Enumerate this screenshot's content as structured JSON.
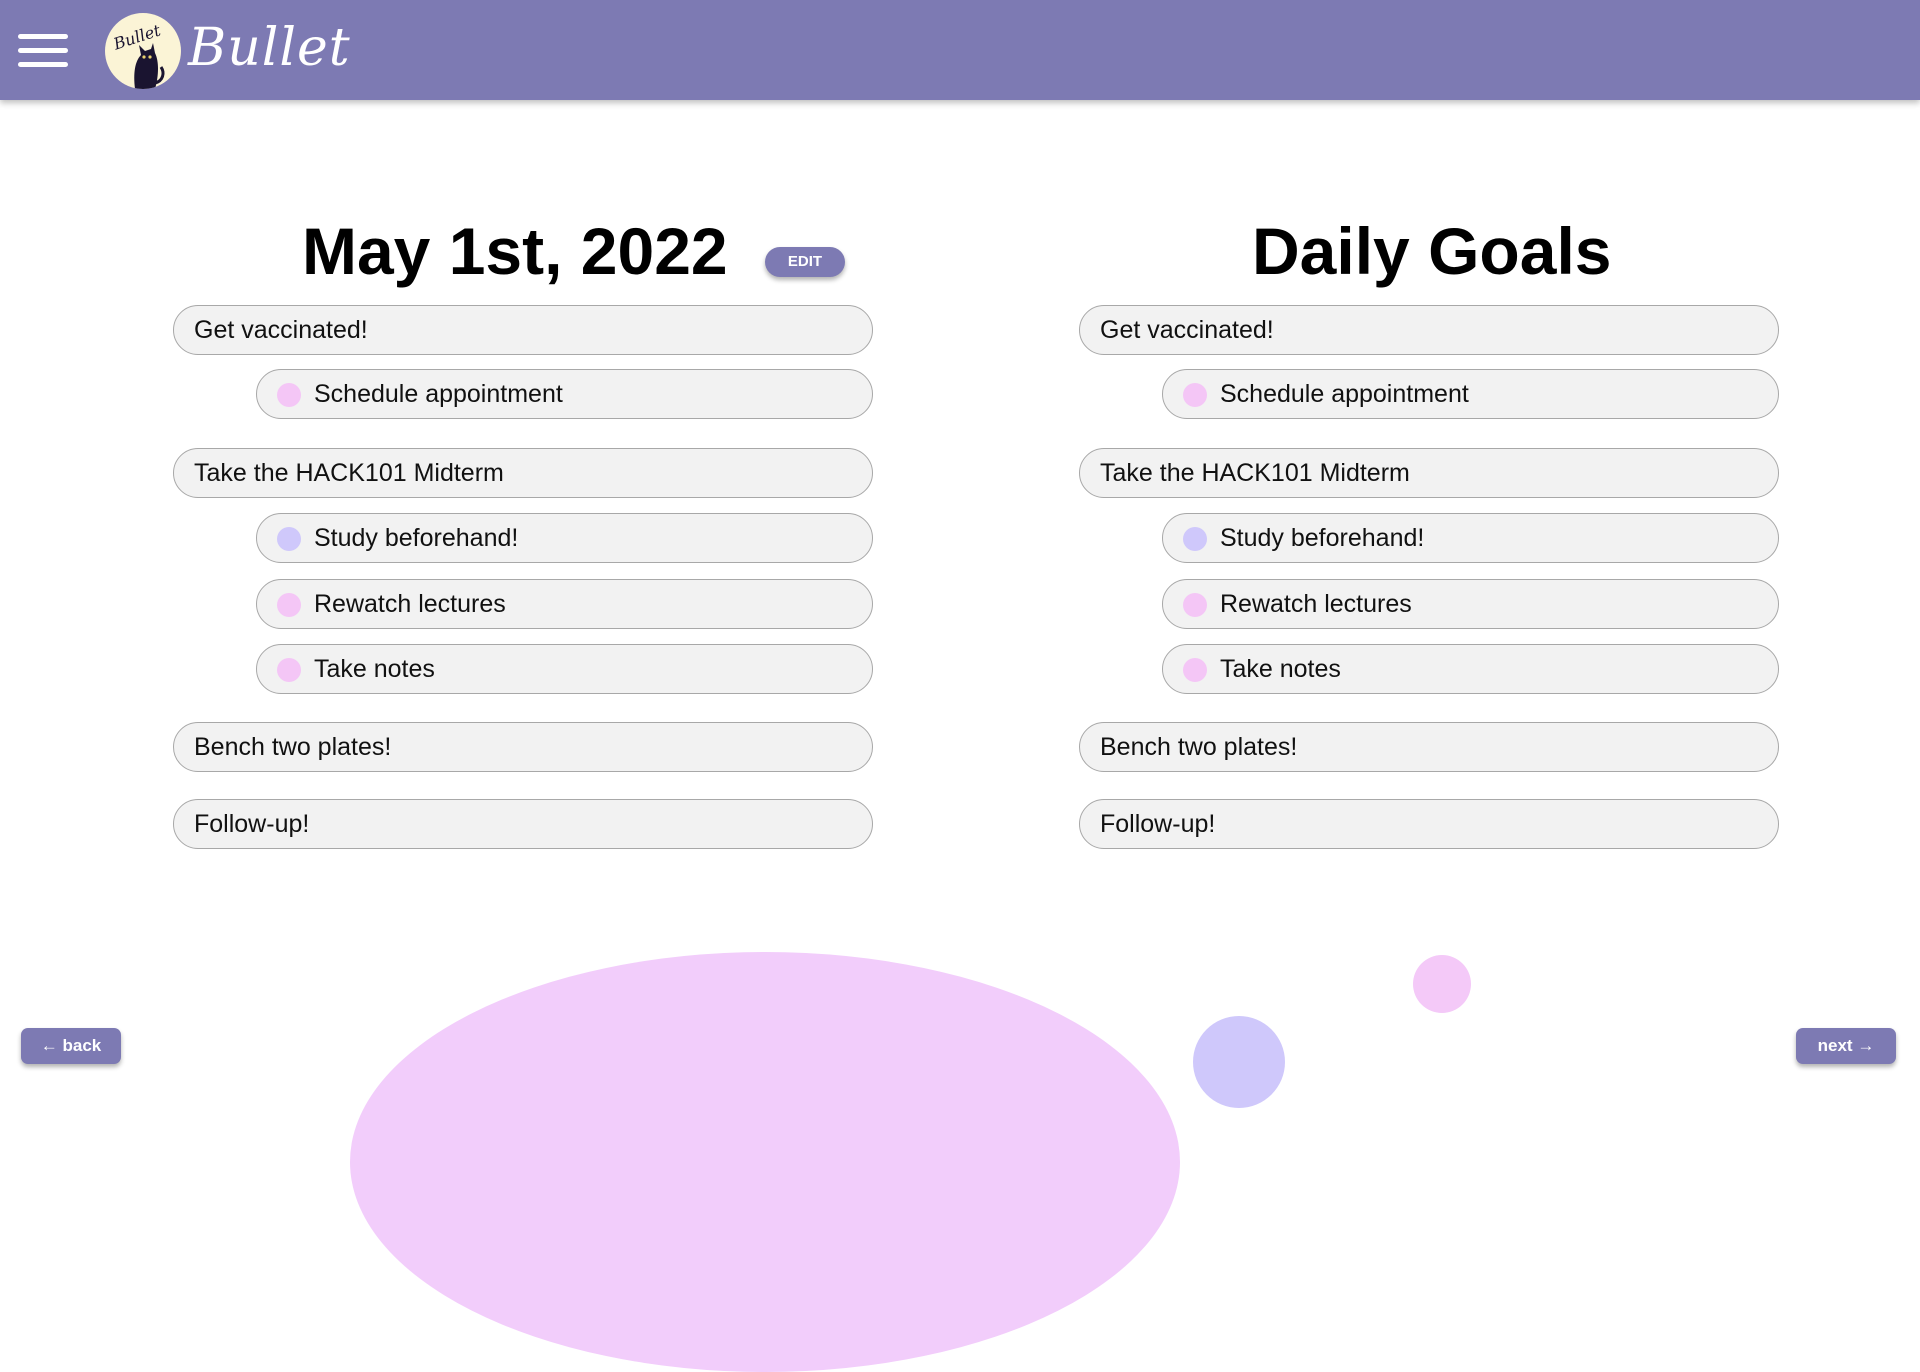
{
  "app": {
    "brand": "Bullet"
  },
  "journal": {
    "title": "May 1st, 2022",
    "edit_label": "EDIT",
    "items": [
      {
        "label": "Get vaccinated!"
      },
      {
        "label": "Schedule appointment",
        "dot_color": "#f4c6f6"
      },
      {
        "label": "Take the HACK101 Midterm"
      },
      {
        "label": "Study beforehand!",
        "dot_color": "#cfc8fb"
      },
      {
        "label": "Rewatch lectures",
        "dot_color": "#f4c6f6"
      },
      {
        "label": "Take notes",
        "dot_color": "#f4c6f6"
      },
      {
        "label": "Bench two plates!"
      },
      {
        "label": "Follow-up!"
      }
    ]
  },
  "goals": {
    "title": "Daily Goals",
    "items": [
      {
        "label": "Get vaccinated!"
      },
      {
        "label": "Schedule appointment",
        "dot_color": "#f4c6f6"
      },
      {
        "label": "Take the HACK101 Midterm"
      },
      {
        "label": "Study beforehand!",
        "dot_color": "#cfc8fb"
      },
      {
        "label": "Rewatch lectures",
        "dot_color": "#f4c6f6"
      },
      {
        "label": "Take notes",
        "dot_color": "#f4c6f6"
      },
      {
        "label": "Bench two plates!"
      },
      {
        "label": "Follow-up!"
      }
    ]
  },
  "nav": {
    "back_label": "back",
    "next_label": "next"
  },
  "colors": {
    "accent": "#7d7ab3",
    "pink": "#f2cdfb",
    "lavender": "#cfc8fb",
    "pill_bg": "#f2f2f2"
  },
  "icons": {
    "menu": "hamburger-icon",
    "logo": "cat-moon-logo",
    "back": "arrow-left-icon",
    "next": "arrow-right-icon"
  }
}
